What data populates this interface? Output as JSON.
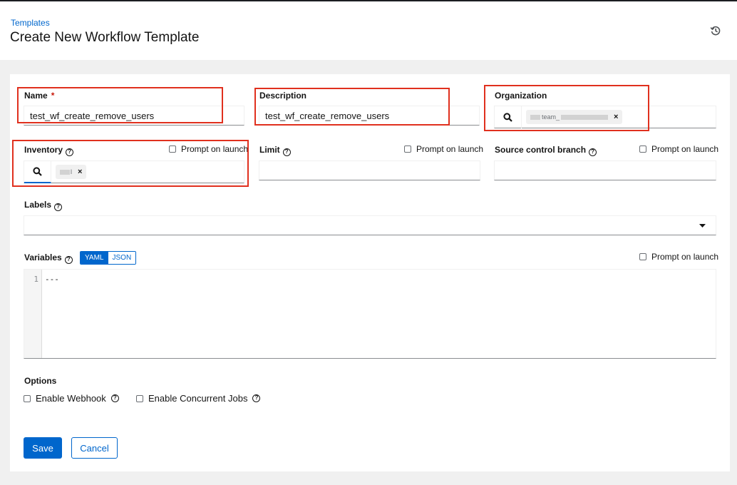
{
  "header": {
    "breadcrumb": "Templates",
    "title": "Create New Workflow Template"
  },
  "form": {
    "name": {
      "label": "Name",
      "required_mark": "*",
      "value": "test_wf_create_remove_users"
    },
    "description": {
      "label": "Description",
      "value": "test_wf_create_remove_users"
    },
    "organization": {
      "label": "Organization",
      "chip": "team_",
      "chip_remove": "×"
    },
    "inventory": {
      "label": "Inventory",
      "prompt": "Prompt on launch",
      "chip": "l",
      "chip_remove": "×"
    },
    "limit": {
      "label": "Limit",
      "prompt": "Prompt on launch",
      "value": ""
    },
    "scm_branch": {
      "label": "Source control branch",
      "prompt": "Prompt on launch",
      "value": ""
    },
    "labels": {
      "label": "Labels"
    },
    "variables": {
      "label": "Variables",
      "mode_yaml": "YAML",
      "mode_json": "JSON",
      "prompt": "Prompt on launch",
      "line_number": "1",
      "content": "---"
    },
    "options": {
      "heading": "Options",
      "webhook": "Enable Webhook",
      "concurrent": "Enable Concurrent Jobs"
    },
    "buttons": {
      "save": "Save",
      "cancel": "Cancel"
    }
  },
  "colors": {
    "accent": "#0066cc",
    "highlight": "#e0301e"
  }
}
